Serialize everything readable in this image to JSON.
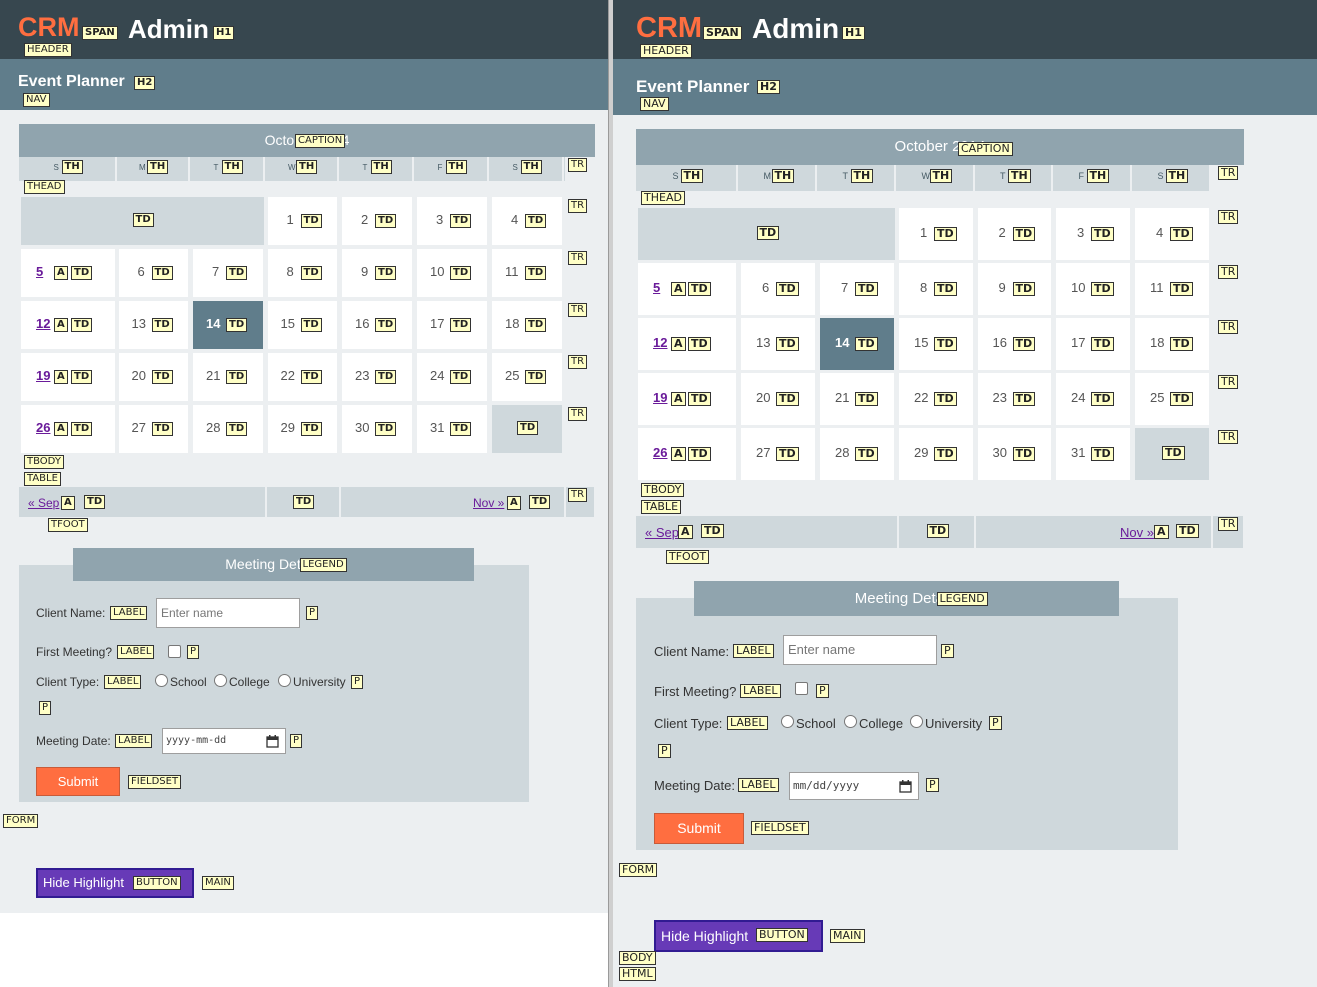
{
  "header": {
    "brand": "CRM",
    "title": "Admin"
  },
  "nav": {
    "title": "Event Planner"
  },
  "calendar": {
    "caption": "October 2014",
    "weekdays": [
      "S",
      "M",
      "T",
      "W",
      "T",
      "F",
      "S"
    ],
    "weeks": [
      [
        null,
        null,
        null,
        "1",
        "2",
        "3",
        "4"
      ],
      [
        "5",
        "6",
        "7",
        "8",
        "9",
        "10",
        "11"
      ],
      [
        "12",
        "13",
        "14",
        "15",
        "16",
        "17",
        "18"
      ],
      [
        "19",
        "20",
        "21",
        "22",
        "23",
        "24",
        "25"
      ],
      [
        "26",
        "27",
        "28",
        "29",
        "30",
        "31",
        null
      ]
    ],
    "today": "14",
    "prev_label": "« Sep",
    "next_label": "Nov »"
  },
  "form": {
    "legend": "Meeting Details",
    "client_name_label": "Client Name:",
    "client_name_placeholder": "Enter name",
    "first_meeting_label": "First Meeting?",
    "client_type_label": "Client Type:",
    "client_types": [
      "School",
      "College",
      "University"
    ],
    "meeting_date_label": "Meeting Date:",
    "date_placeholder_left": "yyyy-mm-dd",
    "date_placeholder_right": "mm/dd/yyyy",
    "submit_label": "Submit"
  },
  "hide_highlight_label": "Hide Highlight",
  "tags": {
    "span": "SPAN",
    "h1": "H1",
    "header": "HEADER",
    "h2": "H2",
    "nav": "NAV",
    "caption": "CAPTION",
    "th": "TH",
    "thead": "THEAD",
    "tr": "TR",
    "td": "TD",
    "a": "A",
    "tbody": "TBODY",
    "table": "TABLE",
    "tfoot": "TFOOT",
    "legend": "LEGEND",
    "label": "LABEL",
    "p": "P",
    "fieldset": "FIELDSET",
    "form": "FORM",
    "button": "BUTTON",
    "main": "MAIN",
    "body": "BODY",
    "html": "HTML"
  },
  "colors": {
    "header_bg": "#37474f",
    "brand": "#ff6e40",
    "nav_bg": "#607d8b",
    "page_bg": "#eceff1",
    "caption_bg": "#90a4ae",
    "muted_bg": "#cfd8dc",
    "today_bg": "#607d8b",
    "submit_bg": "#ff6e40",
    "hide_button_bg": "#673ab7",
    "link": "#6a1b9a",
    "tag_bg": "#ffffc6"
  },
  "icons": [
    "calendar-icon"
  ]
}
